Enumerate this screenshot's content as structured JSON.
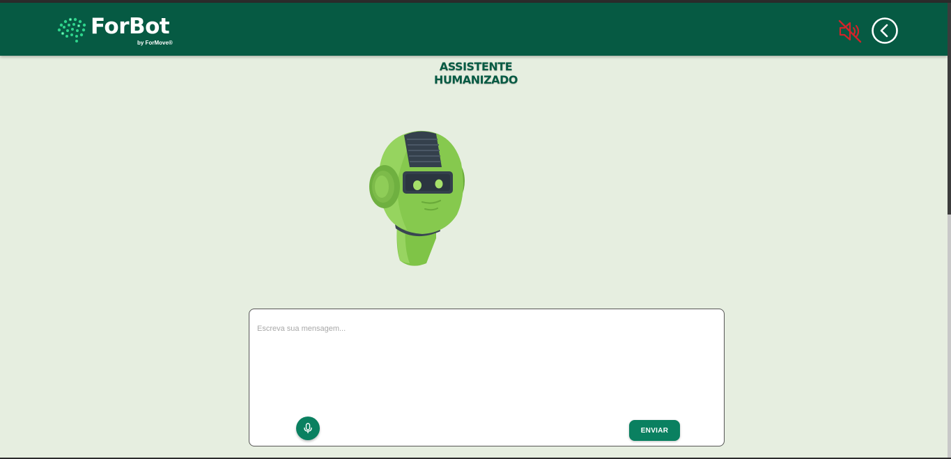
{
  "header": {
    "logo_name": "ForBot",
    "logo_sub": "by ForMove®",
    "mute_icon": "speaker-muted-icon",
    "back_icon": "chevron-left-icon",
    "background": "#065a43",
    "mute_color": "#d1232a"
  },
  "main": {
    "title_line1": "ASSISTENTE",
    "title_line2": "HUMANIZADO",
    "title_color": "#065a43",
    "avatar": "robot-head-illustration"
  },
  "chat": {
    "placeholder": "Escreva sua mensagem...",
    "value": "",
    "mic_icon": "microphone-icon",
    "send_label": "ENVIAR",
    "button_color": "#0a8060"
  }
}
